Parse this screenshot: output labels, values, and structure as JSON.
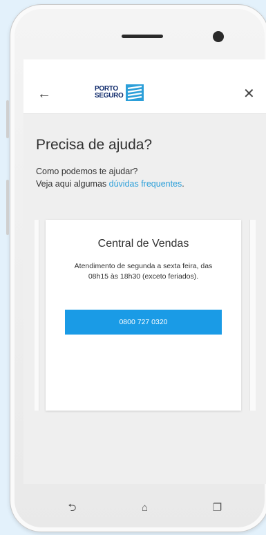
{
  "app": {
    "back_icon": "arrow-left-icon",
    "close_icon": "close-icon",
    "logo": {
      "line1": "PORTO",
      "line2": "SEGURO",
      "mark_color": "#2c9fd9"
    }
  },
  "page": {
    "title": "Precisa de ajuda?",
    "line1": "Como podemos te ajudar?",
    "line2_prefix": "Veja aqui algumas ",
    "faq_link": "dúvidas frequentes",
    "line2_suffix": "."
  },
  "card": {
    "title": "Central de Vendas",
    "text": "Atendimento de segunda a sexta feira, das 08h15 às 18h30 (exceto feriados).",
    "phone_button": "0800 727 0320",
    "button_color": "#1a9be6"
  },
  "navbar": {
    "items": [
      {
        "name": "back",
        "glyph": "⮌"
      },
      {
        "name": "home",
        "glyph": "⌂"
      },
      {
        "name": "recents",
        "glyph": "❐"
      }
    ]
  }
}
